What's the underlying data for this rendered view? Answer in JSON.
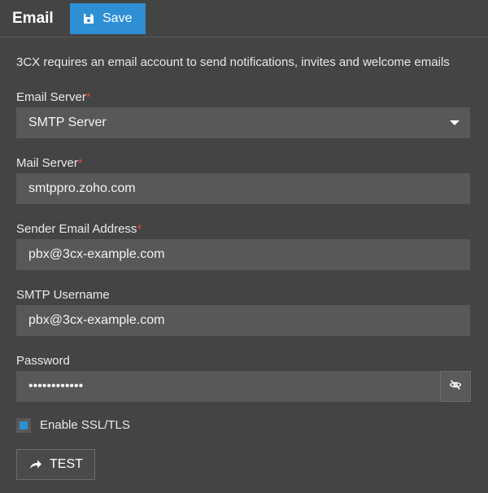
{
  "header": {
    "title": "Email",
    "save_label": "Save",
    "save_icon": "floppy-disk-icon",
    "accent_color": "#2e8fd4"
  },
  "intro_text": "3CX requires an email account to send notifications, invites and welcome emails",
  "fields": {
    "email_server": {
      "label": "Email Server",
      "required": "*",
      "value": "SMTP Server"
    },
    "mail_server": {
      "label": "Mail Server",
      "required": "*",
      "value": "smtppro.zoho.com"
    },
    "sender_email": {
      "label": "Sender Email Address",
      "required": "*",
      "value": "pbx@3cx-example.com"
    },
    "smtp_username": {
      "label": "SMTP Username",
      "value": "pbx@3cx-example.com"
    },
    "password": {
      "label": "Password",
      "value": "••••••••••••",
      "toggle_icon": "eye-slash-icon"
    }
  },
  "ssl": {
    "label": "Enable SSL/TLS",
    "checked": true
  },
  "test_button": {
    "label": "TEST",
    "icon": "share-arrow-icon"
  }
}
